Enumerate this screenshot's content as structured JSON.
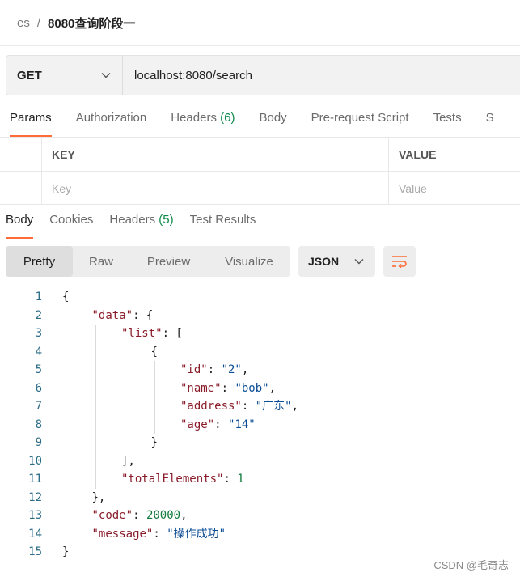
{
  "breadcrumb": {
    "parent": "es",
    "separator": "/",
    "current": "8080查询阶段一"
  },
  "request": {
    "method": "GET",
    "url": "localhost:8080/search"
  },
  "request_tabs": [
    {
      "label": "Params",
      "active": true
    },
    {
      "label": "Authorization"
    },
    {
      "label": "Headers",
      "count": "(6)"
    },
    {
      "label": "Body"
    },
    {
      "label": "Pre-request Script"
    },
    {
      "label": "Tests"
    },
    {
      "label": "S"
    }
  ],
  "params_table": {
    "headers": {
      "key": "KEY",
      "value": "VALUE"
    },
    "placeholders": {
      "key": "Key",
      "value": "Value"
    }
  },
  "response_tabs": [
    {
      "label": "Body",
      "active": true
    },
    {
      "label": "Cookies"
    },
    {
      "label": "Headers",
      "count": "(5)"
    },
    {
      "label": "Test Results"
    }
  ],
  "view_modes": [
    "Pretty",
    "Raw",
    "Preview",
    "Visualize"
  ],
  "active_view_mode": "Pretty",
  "format": "JSON",
  "icons": {
    "method_dropdown": "chevron-down-icon",
    "format_dropdown": "chevron-down-icon",
    "wrap": "wrap-lines-icon"
  },
  "colors": {
    "accent": "#ff6c37",
    "count": "#0f8a4a",
    "json_key": "#8a1c2a",
    "json_string": "#0b4d94",
    "json_number": "#127a3c"
  },
  "code_lines": [
    {
      "n": "1",
      "indent": 0,
      "tokens": [
        [
          "p",
          "{"
        ]
      ]
    },
    {
      "n": "2",
      "indent": 1,
      "tokens": [
        [
          "k",
          "\"data\""
        ],
        [
          "p",
          ": {"
        ]
      ]
    },
    {
      "n": "3",
      "indent": 2,
      "tokens": [
        [
          "k",
          "\"list\""
        ],
        [
          "p",
          ": ["
        ]
      ]
    },
    {
      "n": "4",
      "indent": 3,
      "tokens": [
        [
          "p",
          "{"
        ]
      ]
    },
    {
      "n": "5",
      "indent": 4,
      "tokens": [
        [
          "k",
          "\"id\""
        ],
        [
          "p",
          ": "
        ],
        [
          "s",
          "\"2\""
        ],
        [
          "p",
          ","
        ]
      ]
    },
    {
      "n": "6",
      "indent": 4,
      "tokens": [
        [
          "k",
          "\"name\""
        ],
        [
          "p",
          ": "
        ],
        [
          "s",
          "\"bob\""
        ],
        [
          "p",
          ","
        ]
      ]
    },
    {
      "n": "7",
      "indent": 4,
      "tokens": [
        [
          "k",
          "\"address\""
        ],
        [
          "p",
          ": "
        ],
        [
          "s",
          "\"广东\""
        ],
        [
          "p",
          ","
        ]
      ]
    },
    {
      "n": "8",
      "indent": 4,
      "tokens": [
        [
          "k",
          "\"age\""
        ],
        [
          "p",
          ": "
        ],
        [
          "s",
          "\"14\""
        ]
      ]
    },
    {
      "n": "9",
      "indent": 3,
      "tokens": [
        [
          "p",
          "}"
        ]
      ]
    },
    {
      "n": "10",
      "indent": 2,
      "tokens": [
        [
          "p",
          "],"
        ]
      ]
    },
    {
      "n": "11",
      "indent": 2,
      "tokens": [
        [
          "k",
          "\"totalElements\""
        ],
        [
          "p",
          ": "
        ],
        [
          "n",
          "1"
        ]
      ]
    },
    {
      "n": "12",
      "indent": 1,
      "tokens": [
        [
          "p",
          "},"
        ]
      ]
    },
    {
      "n": "13",
      "indent": 1,
      "tokens": [
        [
          "k",
          "\"code\""
        ],
        [
          "p",
          ": "
        ],
        [
          "n",
          "20000"
        ],
        [
          "p",
          ","
        ]
      ]
    },
    {
      "n": "14",
      "indent": 1,
      "tokens": [
        [
          "k",
          "\"message\""
        ],
        [
          "p",
          ": "
        ],
        [
          "s",
          "\"操作成功\""
        ]
      ]
    },
    {
      "n": "15",
      "indent": 0,
      "tokens": [
        [
          "p",
          "}"
        ]
      ]
    }
  ],
  "watermark": "CSDN @毛奇志"
}
